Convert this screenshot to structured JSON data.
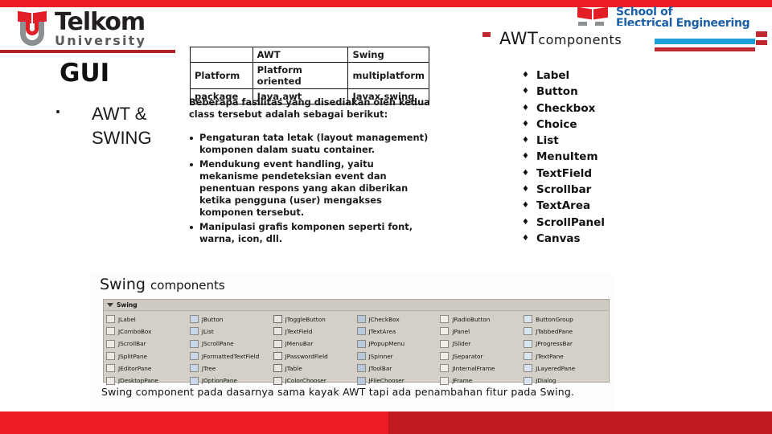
{
  "branding": {
    "telkom": {
      "name": "Telkom",
      "sub": "University"
    },
    "school": {
      "line1": "School of",
      "line2": "Electrical Engineering"
    }
  },
  "title": {
    "heading": "GUI",
    "bullet": "AWT & SWING"
  },
  "comparison_table": {
    "rows": [
      {
        "c0": "",
        "c1": "AWT",
        "c2": "Swing"
      },
      {
        "c0": "Platform",
        "c1": "Platform oriented",
        "c2": "multiplatform"
      },
      {
        "c0": "package",
        "c1": "Java.awt",
        "c2": "Javax.swing"
      }
    ]
  },
  "facilities": {
    "intro": "Beberapa fasilitas yang disediakan oleh kedua class tersebut adalah sebagai berikut:",
    "items": [
      "Pengaturan tata letak (layout management) komponen dalam suatu container.",
      "Mendukung event handling, yaitu mekanisme pendeteksian event dan penentuan respons yang akan diberikan ketika pengguna (user) mengakses komponen tersebut.",
      "Manipulasi grafis komponen seperti font, warna, icon, dll."
    ]
  },
  "awt": {
    "heading_big": "AWT",
    "heading_small": "components",
    "items": [
      "Label",
      "Button",
      "Checkbox",
      "Choice",
      "List",
      "MenuItem",
      "TextField",
      "Scrollbar",
      "TextArea",
      "ScrollPanel",
      "Canvas"
    ]
  },
  "swing": {
    "heading_big": "Swing",
    "heading_small": "components",
    "palette_title": "Swing",
    "components": [
      "JLabel",
      "JButton",
      "JToggleButton",
      "JCheckBox",
      "JRadioButton",
      "ButtonGroup",
      "JComboBox",
      "JList",
      "JTextField",
      "JTextArea",
      "JPanel",
      "JTabbedPane",
      "JScrollBar",
      "JScrollPane",
      "JMenuBar",
      "JPopupMenu",
      "JSlider",
      "JProgressBar",
      "JSplitPane",
      "JFormattedTextField",
      "JPasswordField",
      "JSpinner",
      "JSeparator",
      "JTextPane",
      "JEditorPane",
      "JTree",
      "JTable",
      "JToolBar",
      "JInternalFrame",
      "JLayeredPane",
      "JDesktopPane",
      "JOptionPane",
      "JColorChooser",
      "JFileChooser",
      "JFrame",
      "JDialog"
    ],
    "caption": "Swing component pada dasarnya sama kayak AWT tapi ada penambahan fitur pada Swing."
  },
  "colors": {
    "red": "#ec1c24",
    "dark_red": "#bf1b20",
    "blue": "#1a5fa8",
    "cyan": "#1d9fd9",
    "gray": "#8d9093"
  }
}
